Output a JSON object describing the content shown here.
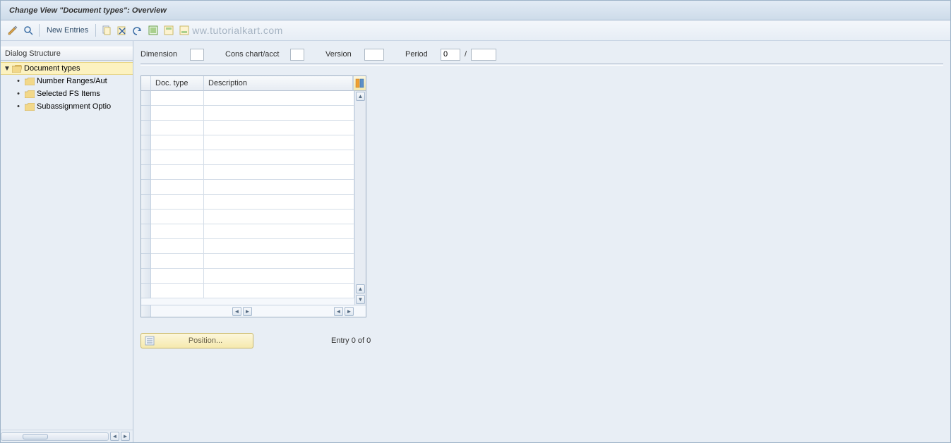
{
  "title": "Change View \"Document types\": Overview",
  "toolbar": {
    "new_entries_label": "New Entries"
  },
  "watermark": "ww.tutorialkart.com",
  "dialog_panel": {
    "header": "Dialog Structure",
    "root": "Document types",
    "children": [
      "Number Ranges/Aut",
      "Selected FS Items",
      "Subassignment Optio"
    ]
  },
  "params": {
    "dimension_label": "Dimension",
    "dimension_value": "",
    "cons_label": "Cons chart/acct",
    "cons_value": "",
    "version_label": "Version",
    "version_value": "",
    "period_label": "Period",
    "period_value_1": "0",
    "period_value_2": ""
  },
  "table": {
    "col_doc": "Doc. type",
    "col_desc": "Description",
    "rows": 14
  },
  "position_label": "Position...",
  "entry_text": "Entry 0 of 0"
}
